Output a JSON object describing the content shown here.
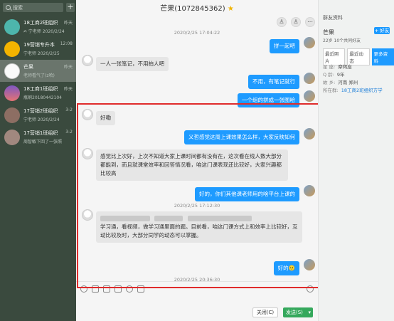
{
  "sidebar": {
    "search_placeholder": "搜索",
    "add_symbol": "+",
    "conversations": [
      {
        "name": "18工商2班组织",
        "preview": "✍ 宁老师 2020/2/24",
        "time": "昨天",
        "avatar_color": "#4db6ac"
      },
      {
        "name": "19营销专升本",
        "preview": "宁老师 2020/2/25",
        "time": "12:08",
        "avatar_color": "#f4b400"
      },
      {
        "name": "芒果",
        "preview": "老师看气了(z哈)",
        "time": "昨天",
        "avatar_color": "#fafafa"
      },
      {
        "name": "18工商1班组织",
        "preview": "瓶刷20180442104",
        "time": "昨天",
        "avatar_color": "#7e57c2"
      },
      {
        "name": "17营销2班组织",
        "preview": "宁老师 2020/2/24",
        "time": "3-2",
        "avatar_color": "#8d6e63"
      },
      {
        "name": "17营销1班组织",
        "preview": "周智敏下回了一张照",
        "time": "3-2",
        "avatar_color": "#a1887f"
      }
    ]
  },
  "chat": {
    "title": "芒果(1072845362)",
    "title_star": "★",
    "header_icons": [
      "add-user-icon",
      "add-group-icon",
      "more-icon"
    ],
    "messages": [
      {
        "type": "timestamp",
        "text": "2020/2/25 17:04:22"
      },
      {
        "type": "right",
        "text": "拼一起吧"
      },
      {
        "type": "left",
        "text": "一人一张笔记，不用拍人吧"
      },
      {
        "type": "right",
        "text": "不用，有笔记就行"
      },
      {
        "type": "right",
        "text": "一个组的拼成一张图哈"
      },
      {
        "type": "left",
        "text": "好嘞"
      },
      {
        "type": "right",
        "text": "义哲感觉这周上课效果怎么样，大家反映如何"
      },
      {
        "type": "left",
        "text": "感觉比上次好，上次不知道大家上课时间都有没有在，这次看在线人数大部分都能到，而且就课堂效率和回答情况看，咱这门课表现还比较好，大家兴趣都比较高"
      },
      {
        "type": "right",
        "text": "好的，你们其他课老师用的啥平台上课的"
      },
      {
        "type": "timestamp",
        "text": "2020/2/25 17:12:30"
      },
      {
        "type": "left",
        "text": "学习通，看视频，做学习通里面的题。目前看，咱这门课方式上和效率上比较好，互动比较及时，大部分同学的动态可以掌握。"
      },
      {
        "type": "right",
        "text": "好的🙂"
      },
      {
        "type": "timestamp",
        "text": "2020/2/25 20:36:30"
      }
    ]
  },
  "input": {
    "tools": [
      "emoji-icon",
      "scissors-icon",
      "folder-icon",
      "image-icon",
      "bubble-icon",
      "more-icon"
    ],
    "close_label": "关闭(C)",
    "send_label": "发送(S)"
  },
  "profile": {
    "title": "群友资料",
    "name": "芒果",
    "add_friend": "+ 好友",
    "subtitle": "22岁 10个共同好友",
    "tabs": [
      "最近照片",
      "最近动态",
      "更多资料"
    ],
    "active_tab": 2,
    "rows": [
      {
        "label": "星 座:",
        "value": "摩羯座"
      },
      {
        "label": "Q 龄:",
        "value": "9年"
      },
      {
        "label": "故 乡:",
        "value": "河南 郑州"
      },
      {
        "label": "所在群:",
        "value": "18工商2班组织方学",
        "link": true
      }
    ]
  },
  "colors": {
    "accent": "#1e9bff",
    "highlight_box": "#e02b2b",
    "send_button": "#35a85c",
    "sidebar_bg": "#3a4a3e"
  }
}
